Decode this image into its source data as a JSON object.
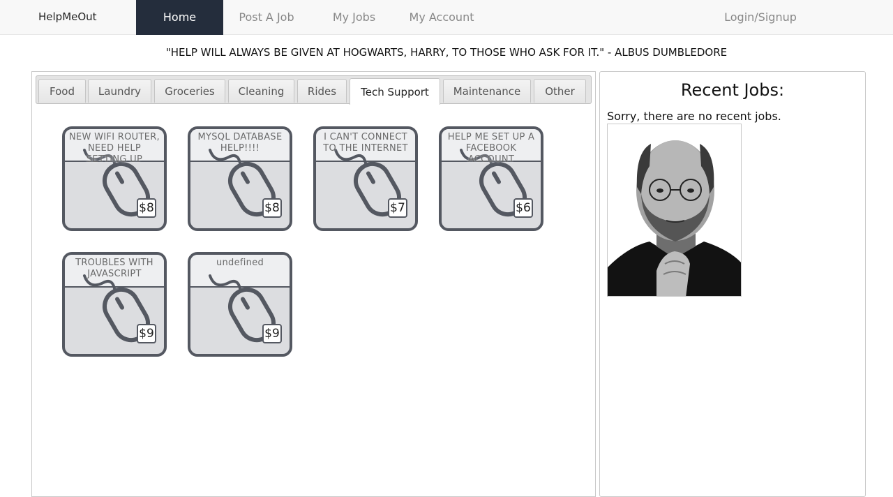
{
  "nav": {
    "brand": "HelpMeOut",
    "items": [
      {
        "label": "Home",
        "active": true
      },
      {
        "label": "Post A Job",
        "active": false
      },
      {
        "label": "My Jobs",
        "active": false
      },
      {
        "label": "My Account",
        "active": false
      }
    ],
    "login": "Login/Signup"
  },
  "quote": "\"HELP WILL ALWAYS BE GIVEN AT HOGWARTS, HARRY, TO THOSE WHO ASK FOR IT.\" - ALBUS DUMBLEDORE",
  "tabs": [
    {
      "label": "Food",
      "active": false
    },
    {
      "label": "Laundry",
      "active": false
    },
    {
      "label": "Groceries",
      "active": false
    },
    {
      "label": "Cleaning",
      "active": false
    },
    {
      "label": "Rides",
      "active": false
    },
    {
      "label": "Tech Support",
      "active": true
    },
    {
      "label": "Maintenance",
      "active": false
    },
    {
      "label": "Other",
      "active": false
    }
  ],
  "jobs": [
    {
      "title": "NEW WIFI ROUTER, NEED HELP SETTING UP",
      "price": "$8",
      "icon": "computer-mouse-icon"
    },
    {
      "title": "MYSQL DATABASE HELP!!!!",
      "price": "$8",
      "icon": "computer-mouse-icon"
    },
    {
      "title": "I CAN'T CONNECT TO THE INTERNET",
      "price": "$7",
      "icon": "computer-mouse-icon"
    },
    {
      "title": "HELP ME SET UP A FACEBOOK ACCOUNT",
      "price": "$6",
      "icon": "computer-mouse-icon"
    },
    {
      "title": "TROUBLES WITH JAVASCRIPT",
      "price": "$9",
      "icon": "computer-mouse-icon"
    },
    {
      "title": "undefined",
      "price": "$9",
      "icon": "computer-mouse-icon"
    }
  ],
  "recent": {
    "title": "Recent Jobs:",
    "message": "Sorry, there are no recent jobs."
  },
  "colors": {
    "nav_active_bg": "#242d3c",
    "card_border": "#545861",
    "card_body": "#dcdde0"
  }
}
